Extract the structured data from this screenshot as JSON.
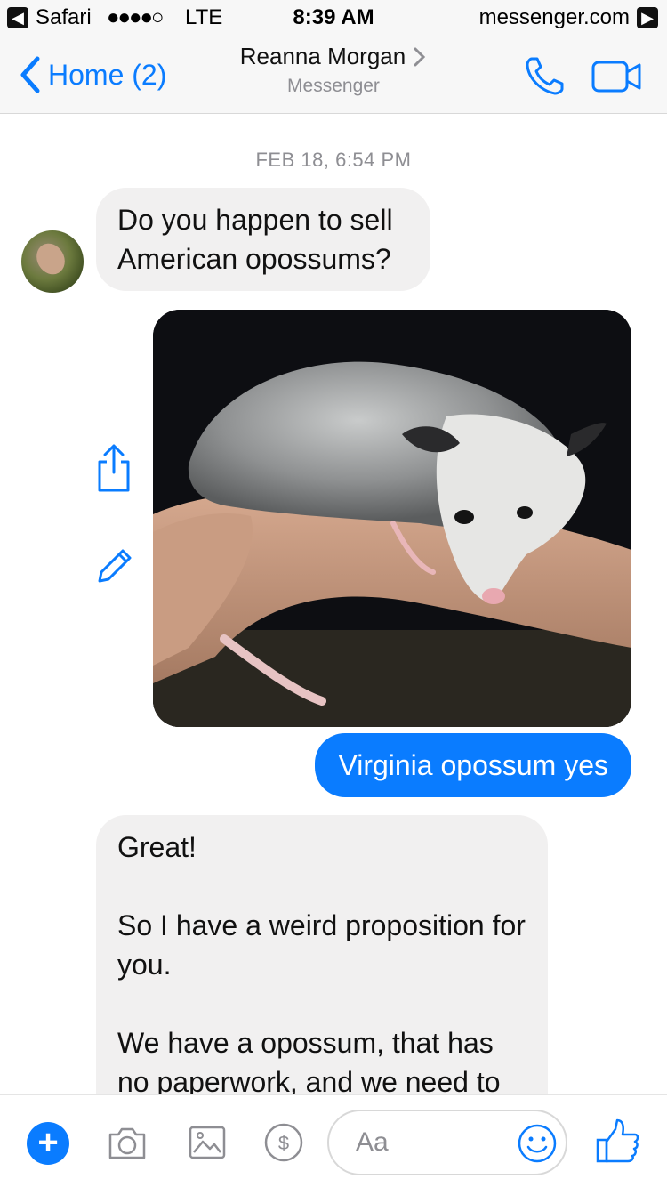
{
  "status_bar": {
    "back_app": "Safari",
    "signal": "●●●●○",
    "carrier": "LTE",
    "time": "8:39 AM",
    "site": "messenger.com"
  },
  "nav": {
    "back_label": "Home (2)",
    "contact_name": "Reanna Morgan",
    "subtitle": "Messenger",
    "accent_color": "#0a7cff"
  },
  "chat": {
    "timestamp": "FEB 18, 6:54 PM",
    "messages": [
      {
        "from": "them",
        "text": "Do you happen to sell American opossums?"
      },
      {
        "from": "me",
        "type": "photo",
        "alt": ""
      },
      {
        "from": "me",
        "text": "Virginia opossum yes"
      },
      {
        "from": "them",
        "paragraphs": [
          "Great!",
          "So I have a weird proposition for you.",
          "We have a opossum, that has no paperwork, and we need to"
        ]
      }
    ]
  },
  "composer": {
    "placeholder": "Aa",
    "icons": [
      "plus-icon",
      "camera-icon",
      "gallery-icon",
      "payment-icon",
      "emoji-icon",
      "like-icon"
    ]
  }
}
